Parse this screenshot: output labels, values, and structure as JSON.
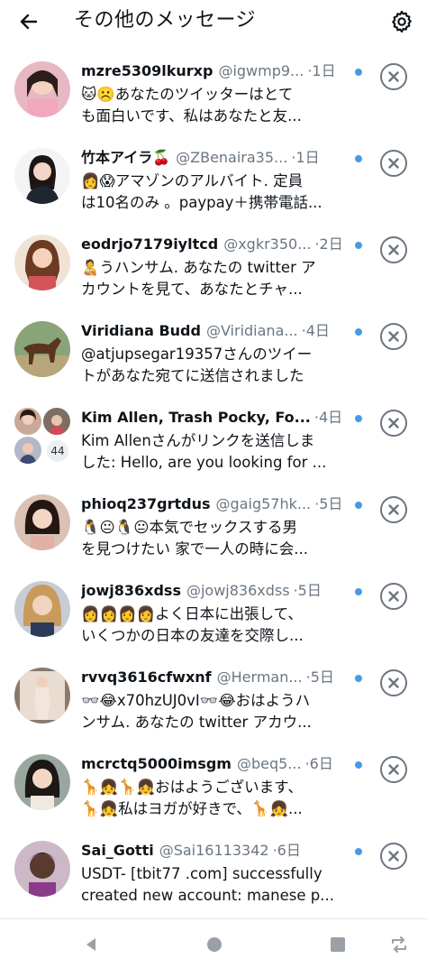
{
  "header": {
    "title": "その他のメッセージ",
    "back_icon": "arrow-left-icon",
    "settings_icon": "gear-icon"
  },
  "accent_color": "#4a99e9",
  "messages": [
    {
      "name": "mzre5309lkurxp",
      "handle": "@igwmp9...",
      "sep": "·",
      "time": "1日",
      "line1": "🐱☹️あなたのツイッターはとて",
      "line2": "も面白いです、私はあなたと友..."
    },
    {
      "name": "竹本アイラ🍒",
      "handle": "@ZBenaira35...",
      "sep": "·",
      "time": "1日",
      "line1": "👩😱アマゾンのアルバイト. 定員",
      "line2": "は10名のみ 。paypay＋携帯電話..."
    },
    {
      "name": "eodrjo7179iyltcd",
      "handle": "@xgkr350...",
      "sep": "·",
      "time": "2日",
      "line1": "🧑‍🍼うハンサム. あなたの twitter ア",
      "line2": "カウントを見て、あなたとチャ..."
    },
    {
      "name": "Viridiana Budd",
      "handle": "@Viridiana...",
      "sep": "·",
      "time": "4日",
      "line1": "@atjupsegar19357さんのツイー",
      "line2": "トがあなた宛てに送信されました"
    },
    {
      "name": "Kim Allen, Trash Pocky, Fo...",
      "handle": "",
      "sep": "·",
      "time": "4日",
      "line1": "Kim Allenさんがリンクを送信しま",
      "line2": "した: Hello, are you looking for ...",
      "group_count": "44"
    },
    {
      "name": "phioq237grtdus",
      "handle": "@gaig57hk...",
      "sep": "·",
      "time": "5日",
      "line1": "🐧😐🐧😐本気でセックスする男",
      "line2": "を見つけたい 家で一人の時に会..."
    },
    {
      "name": "jowj836xdss",
      "handle": "@jowj836xdss",
      "sep": "·",
      "time": "5日",
      "line1": "👩👩👩👩よく日本に出張して、",
      "line2": "いくつかの日本の友達を交際し..."
    },
    {
      "name": "rvvq3616cfwxnf",
      "handle": "@Herman...",
      "sep": "·",
      "time": "5日",
      "line1": "👓😂x70hzUJ0vI👓😂おはようハ",
      "line2": "ンサム. あなたの twitter アカウ..."
    },
    {
      "name": "mcrctq5000imsgm",
      "handle": "@beq5...",
      "sep": "·",
      "time": "6日",
      "line1": "🦒👧🦒👧おはようございます、",
      "line2": "🦒👧私はヨガが好きで、🦒👧..."
    },
    {
      "name": "Sai_Gotti",
      "handle": "@Sai16113342",
      "sep": "·",
      "time": "6日",
      "line1": "USDT- [tbit77 .com] successfully",
      "line2": "created new account: manese p..."
    }
  ],
  "navbar": {
    "back_icon": "triangle-back-icon",
    "home_icon": "circle-home-icon",
    "recents_icon": "square-recents-icon",
    "rotate_icon": "rotate-icon"
  }
}
